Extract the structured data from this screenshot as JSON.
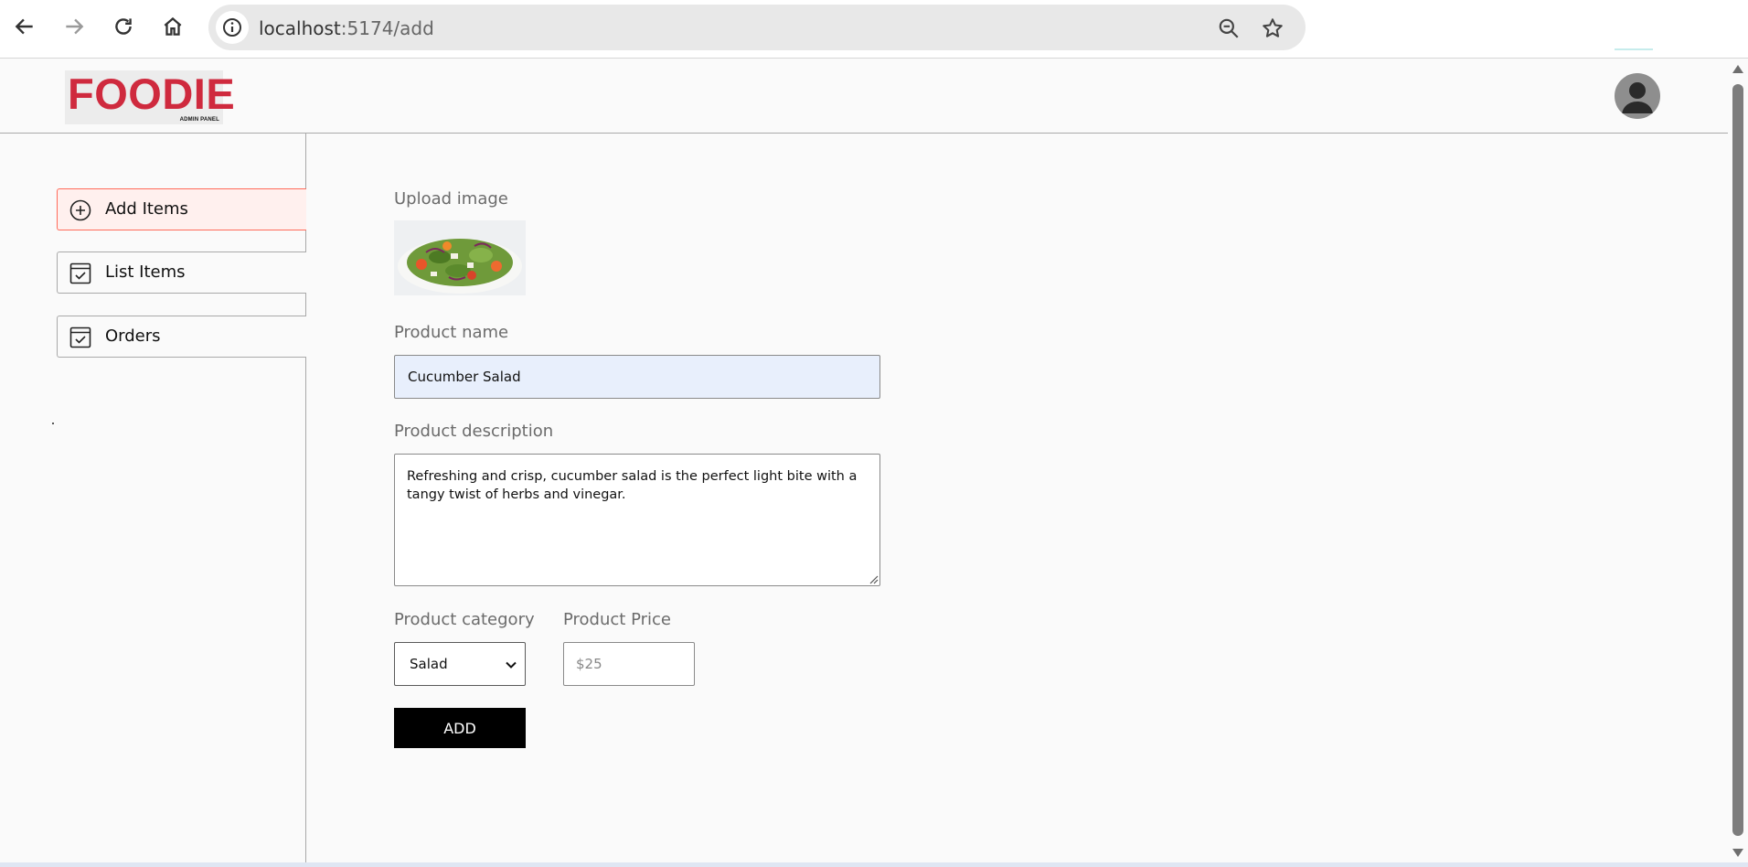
{
  "browser": {
    "url_host": "localhost",
    "url_path": ":5174/add",
    "back_icon": "arrow-left-icon",
    "forward_icon": "arrow-right-icon",
    "reload_icon": "reload-icon",
    "home_icon": "home-icon",
    "site_info_icon": "info-icon",
    "zoom_icon": "zoom-out-icon",
    "bookmark_icon": "star-icon"
  },
  "header": {
    "logo_text": "FOODIE",
    "logo_subtext": "ADMIN PANEL",
    "avatar_icon": "user-avatar-icon"
  },
  "sidebar": {
    "items": [
      {
        "label": "Add Items",
        "icon": "add-circle-icon",
        "active": true
      },
      {
        "label": "List Items",
        "icon": "checkbox-list-icon",
        "active": false
      },
      {
        "label": "Orders",
        "icon": "checkbox-orders-icon",
        "active": false
      }
    ]
  },
  "form": {
    "upload_label": "Upload image",
    "upload_image_alt": "salad-image",
    "name_label": "Product name",
    "name_value": "Cucumber Salad",
    "description_label": "Product description",
    "description_value": "Refreshing and crisp, cucumber salad is the perfect light bite with a tangy twist of herbs and vinegar.",
    "category_label": "Product category",
    "category_value": "Salad",
    "price_label": "Product Price",
    "price_placeholder": "$25",
    "add_button_label": "ADD"
  },
  "colors": {
    "brand_red": "#cf2a3e",
    "active_bg": "#fff0ee",
    "active_border": "#ff6b5a",
    "input_fill": "#e8effc",
    "button_bg": "#000000"
  }
}
